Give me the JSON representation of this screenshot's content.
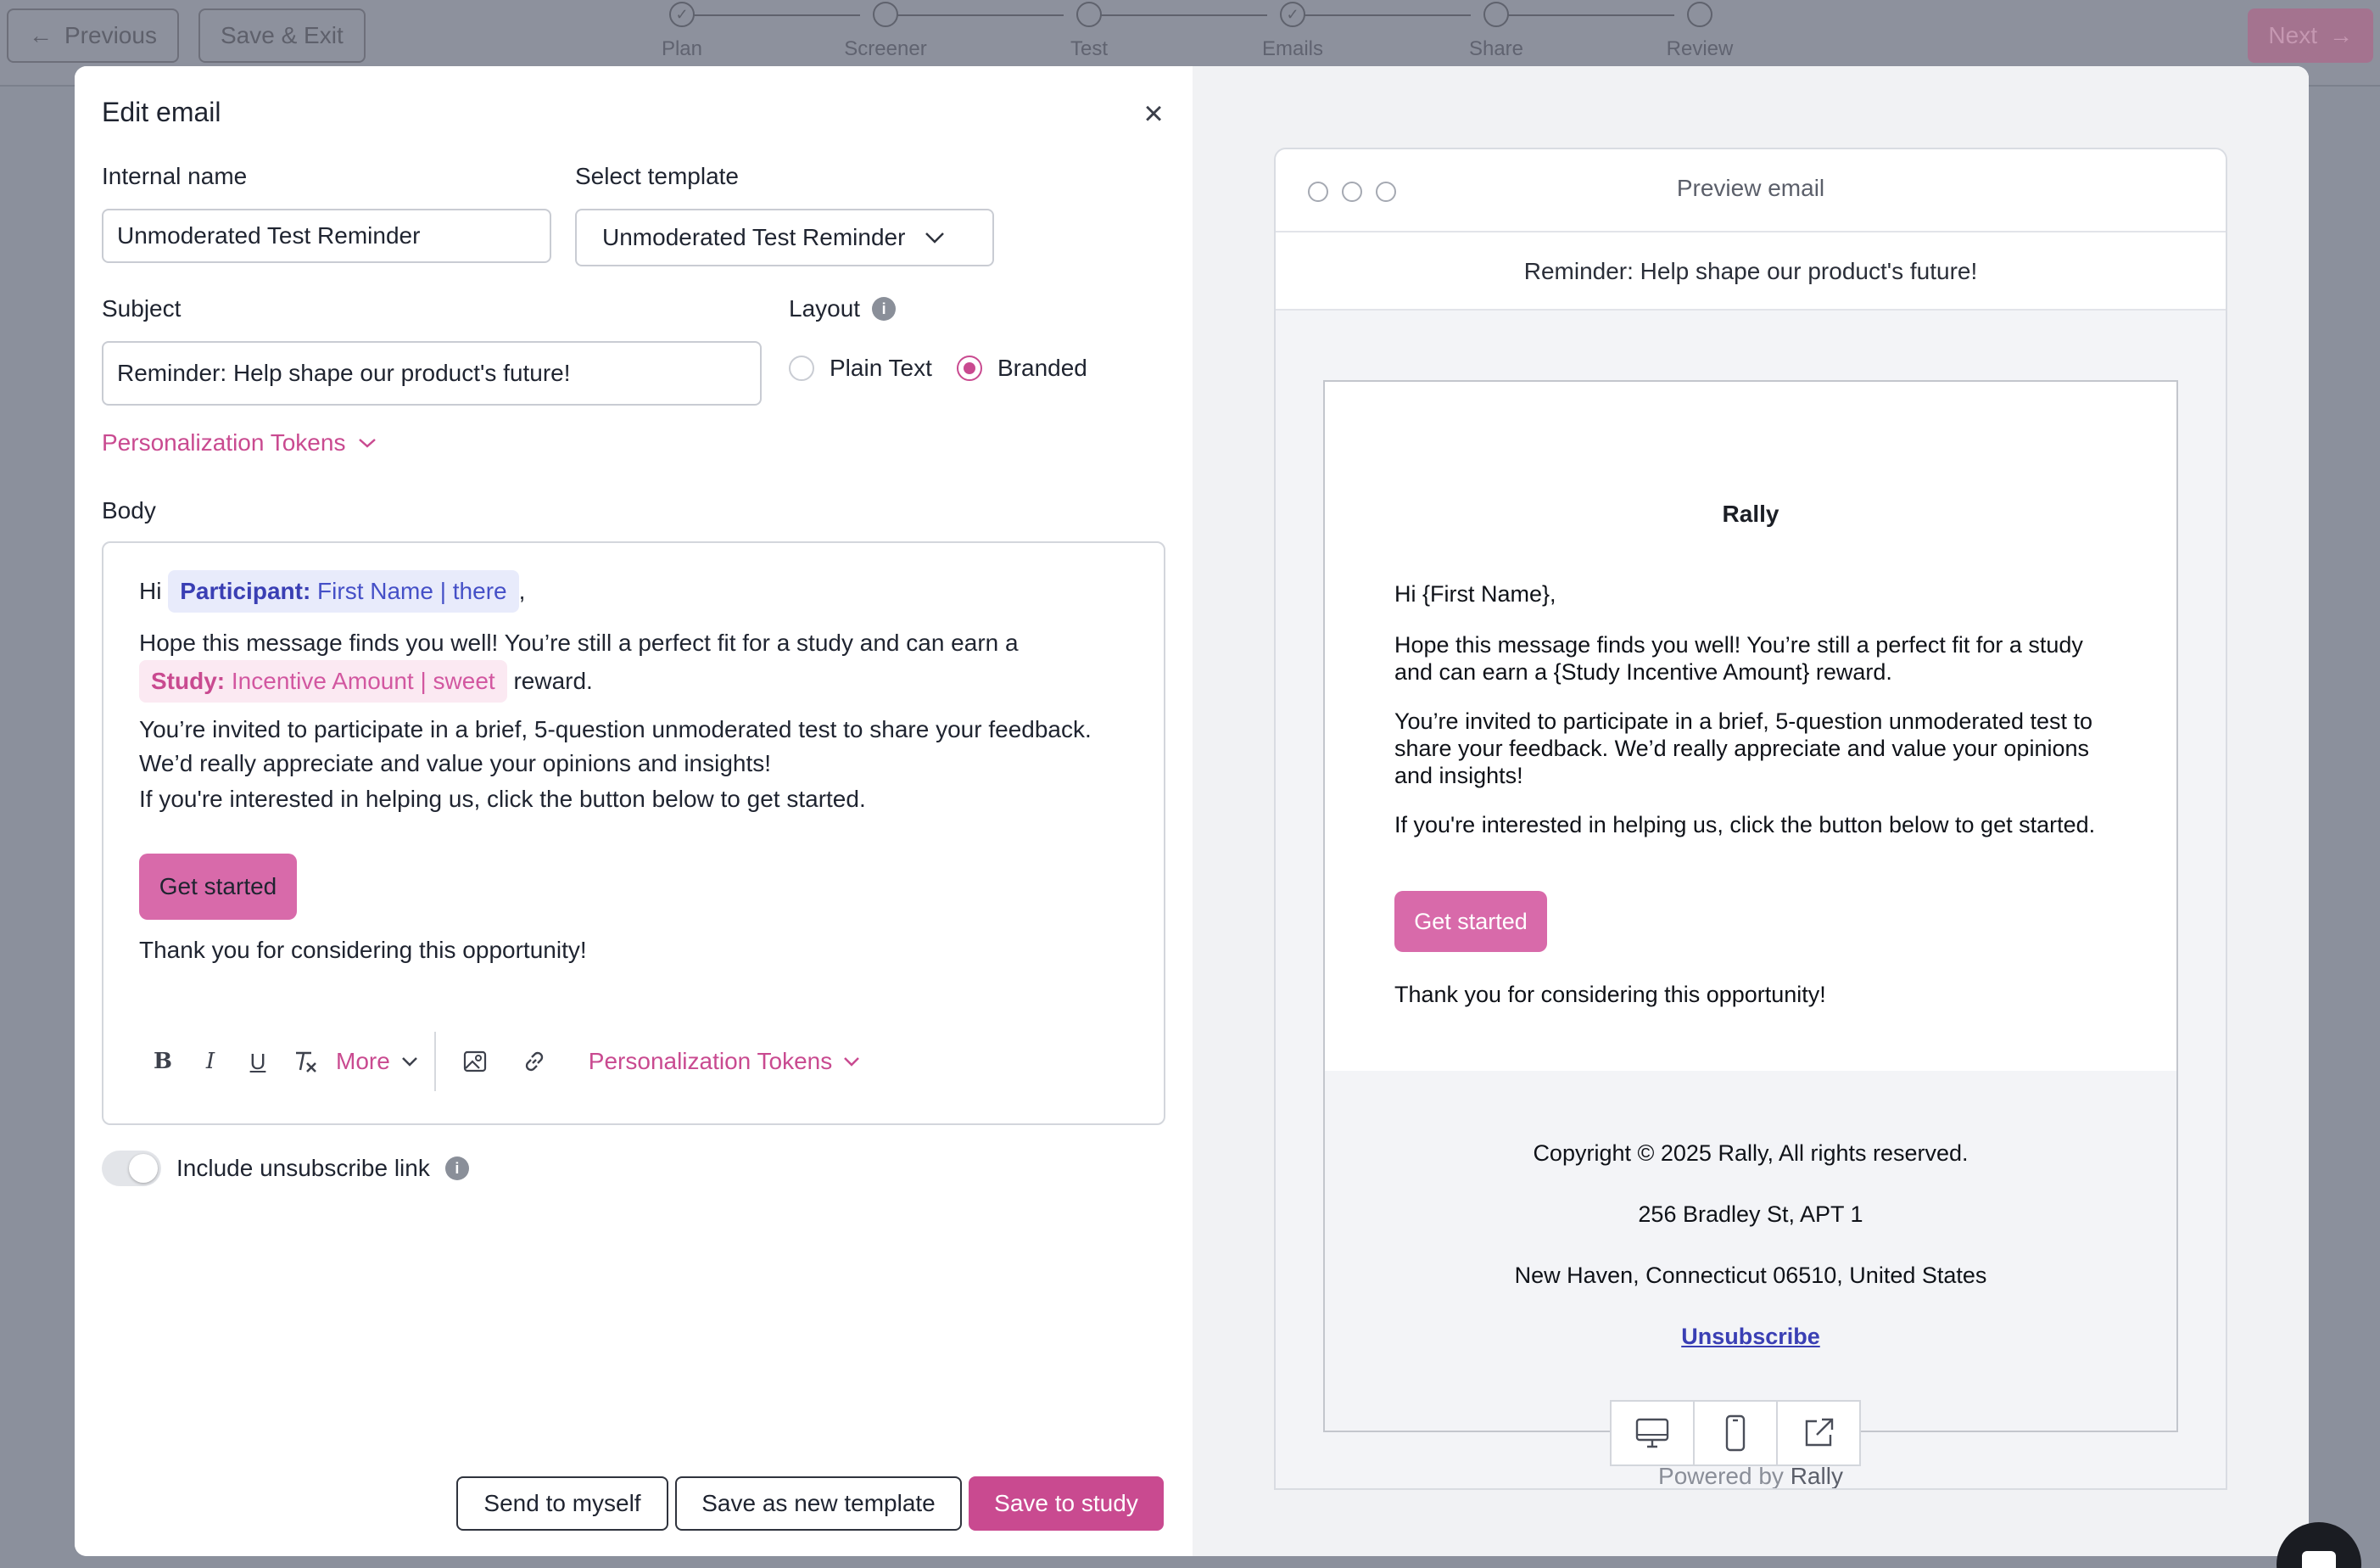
{
  "topbar": {
    "previous": "Previous",
    "save_exit": "Save & Exit",
    "next": "Next",
    "steps": [
      "Plan",
      "Screener",
      "Test",
      "Emails",
      "Share",
      "Review"
    ]
  },
  "modal": {
    "title": "Edit email",
    "internal_name_label": "Internal name",
    "internal_name_value": "Unmoderated Test Reminder",
    "template_label": "Select template",
    "template_value": "Unmoderated Test Reminder",
    "subject_label": "Subject",
    "subject_value": "Reminder: Help shape our product's future!",
    "layout_label": "Layout",
    "layout_options": [
      "Plain Text",
      "Branded"
    ],
    "layout_selected": "Branded",
    "personalization_tokens": "Personalization Tokens",
    "body_label": "Body",
    "body": {
      "greeting": "Hi",
      "comma": ",",
      "token1_key": "Participant:",
      "token1_value": "First Name | there",
      "para1_a": "Hope this message finds you well! You’re still a perfect fit for a study and can earn a",
      "token2_key": "Study:",
      "token2_value": "Incentive Amount | sweet",
      "para1_b": "reward.",
      "para2": "You’re invited to participate in a brief, 5-question unmoderated test to share your feedback. We’d really appreciate and value your opinions and insights!",
      "para3": "If you're interested in helping us, click the button below to get started.",
      "button": "Get started",
      "closing": "Thank you for considering this opportunity!"
    },
    "toolbar": {
      "more": "More",
      "personalization_tokens": "Personalization Tokens"
    },
    "unsubscribe_label": "Include unsubscribe link",
    "send_to_myself": "Send to myself",
    "save_new_template": "Save as new template",
    "save_to_study": "Save to study"
  },
  "preview": {
    "title": "Preview email",
    "subject": "Reminder: Help shape our product's future!",
    "brand": "Rally",
    "greeting": "Hi {First Name},",
    "para1": "Hope this message finds you well! You’re still a perfect fit for a study and can earn a {Study Incentive Amount} reward.",
    "para2": "You’re invited to participate in a brief, 5-question unmoderated test to share your feedback. We’d really appreciate and value your opinions and insights!",
    "para3": "If you're interested in helping us, click the button below to get started.",
    "button": "Get started",
    "closing": "Thank you for considering this opportunity!",
    "copyright": "Copyright © 2025 Rally, All rights reserved.",
    "address1": "256 Bradley St, APT 1",
    "address2": "New Haven, Connecticut 06510, United States",
    "unsubscribe": "Unsubscribe",
    "powered_by": "Powered by",
    "powered_brand": "Rally"
  },
  "colors": {
    "accent": "#c94a90",
    "token_blue": "#3a3fb4",
    "overlay": "#8b909c"
  }
}
